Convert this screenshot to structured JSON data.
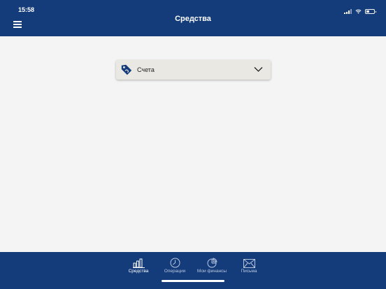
{
  "status_bar": {
    "time": "15:58"
  },
  "header": {
    "title": "Средства"
  },
  "account_selector": {
    "label": "Счета"
  },
  "tabs": [
    {
      "label": "Средства",
      "icon": "bar-chart-icon",
      "active": true
    },
    {
      "label": "Операции",
      "icon": "clock-icon",
      "active": false
    },
    {
      "label": "Мои финансы",
      "icon": "pie-chart-icon",
      "active": false
    },
    {
      "label": "Письма",
      "icon": "envelope-icon",
      "active": false
    }
  ],
  "colors": {
    "brand": "#143c7a",
    "background": "#f4f4f4",
    "dropdown": "#e9e8e3"
  }
}
